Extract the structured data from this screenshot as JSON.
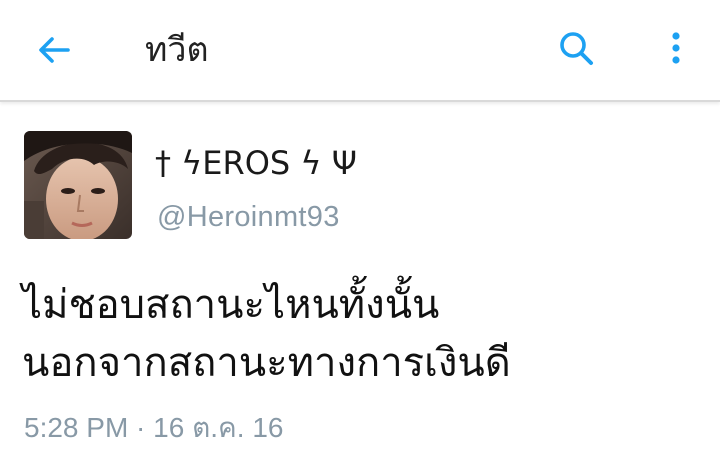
{
  "header": {
    "title": "ทวีต",
    "back_icon": "arrow-left-icon",
    "search_icon": "search-icon",
    "menu_icon": "more-vertical-icon",
    "accent_color": "#1da1f2"
  },
  "tweet": {
    "author": {
      "display_name": "† ϟEROS ϟ Ψ",
      "handle": "@Heroinmt93"
    },
    "text_lines": [
      "ไม่ชอบสถานะไหนทั้งนั้น",
      "นอกจากสถานะทางการเงินดี"
    ],
    "timestamp": "5:28 PM · 16 ต.ค. 16"
  }
}
